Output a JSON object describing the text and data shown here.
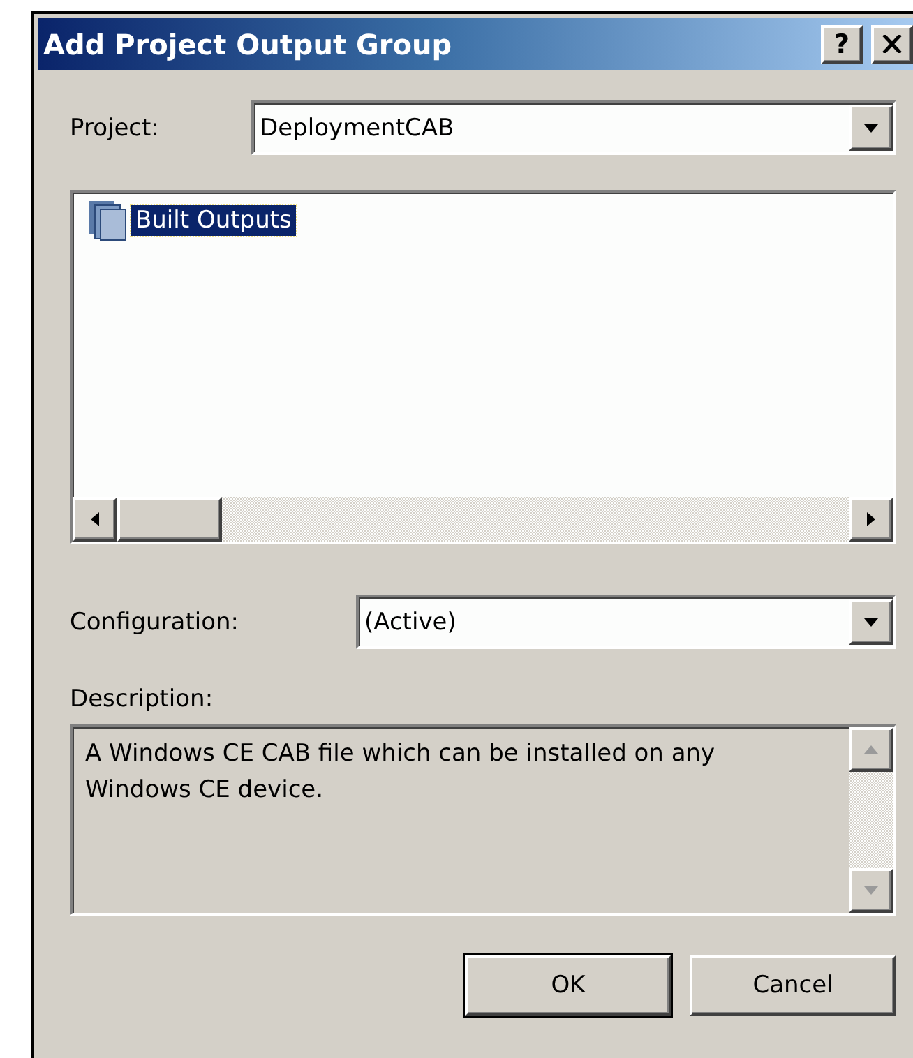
{
  "window": {
    "title": "Add Project Output Group",
    "help_label": "?"
  },
  "project": {
    "label": "Project:",
    "value": "DeploymentCAB"
  },
  "outputs": {
    "items": [
      {
        "label": "Built Outputs",
        "selected": true
      }
    ]
  },
  "configuration": {
    "label": "Configuration:",
    "value": "(Active)"
  },
  "description": {
    "label": "Description:",
    "text": "A Windows CE CAB file which can be installed on any Windows CE device."
  },
  "buttons": [
    {
      "label": "OK",
      "default": true
    },
    {
      "label": "Cancel",
      "default": false
    }
  ]
}
